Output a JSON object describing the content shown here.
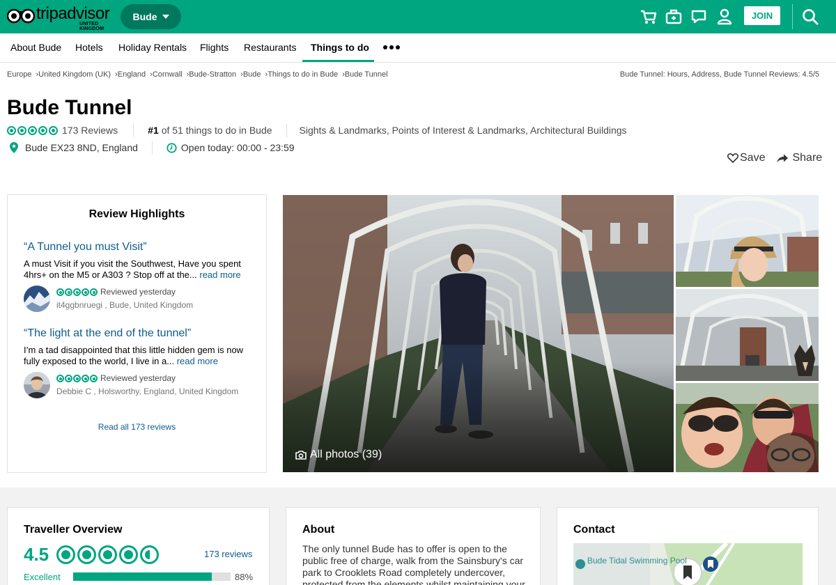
{
  "header": {
    "logo_text": "tripadvisor",
    "logo_sub": "UNITED KINGDOM",
    "location_pill": "Bude",
    "join_label": "JOIN",
    "icons": [
      "cart-icon",
      "trips-icon",
      "messages-icon",
      "profile-icon",
      "search-icon"
    ]
  },
  "nav": {
    "items": [
      "About Bude",
      "Hotels",
      "Holiday Rentals",
      "Flights",
      "Restaurants",
      "Things to do"
    ],
    "active": "Things to do"
  },
  "breadcrumb": {
    "items": [
      "Europe",
      "United Kingdom (UK)",
      "England",
      "Cornwall",
      "Bude-Stratton",
      "Bude",
      "Things to do in Bude",
      "Bude Tunnel"
    ],
    "right": "Bude Tunnel: Hours, Address, Bude Tunnel Reviews: 4.5/5"
  },
  "attraction": {
    "title": "Bude Tunnel",
    "reviews_count": "173 Reviews",
    "rank_number": "#1",
    "rank_text": "of 51 things to do in Bude",
    "categories": "Sights & Landmarks, Points of Interest & Landmarks, Architectural Buildings",
    "address": "Bude EX23 8ND, England",
    "hours": "Open today: 00:00 - 23:59",
    "save_label": "Save",
    "share_label": "Share",
    "rating": 4.5
  },
  "review_highlights": {
    "title": "Review Highlights",
    "reviews": [
      {
        "quote": "“A Tunnel you must Visit”",
        "text": "A must Visit if you visit the Southwest, Have you spent 4hrs+ on the M5 or A303 ? Stop off at the...",
        "more": "read more",
        "meta": "Reviewed yesterday",
        "author": "it4ggbnruegi , Bude, United Kingdom",
        "rating": 5
      },
      {
        "quote": "“The light at the end of the tunnel”",
        "text": "I’m a tad disappointed that this little hidden gem is now fully exposed to the world, I live in a...",
        "more": "read more",
        "meta": "Reviewed yesterday",
        "author": "Debbie C , Holsworthy, England, United Kingdom",
        "rating": 5
      }
    ],
    "read_all": "Read all 173 reviews"
  },
  "photos": {
    "all_photos_label": "All photos (39)"
  },
  "traveller_overview": {
    "title": "Traveller Overview",
    "score": "4.5",
    "reviews_link": "173 reviews",
    "rows": [
      {
        "label": "Excellent",
        "percent": 88,
        "percent_label": "88%"
      }
    ]
  },
  "about": {
    "title": "About",
    "text": "The only tunnel Bude has to offer is open to the public free of charge, walk from the Sainsbury's car park to Crooklets Road completely undercover, protected from the elements whilst maintaining your view to the"
  },
  "contact": {
    "title": "Contact",
    "map_label": "Bude Tidal Swimming Pool"
  },
  "colors": {
    "brand": "#00a680",
    "brand_dark": "#00785e",
    "link": "#0e5c8d"
  }
}
